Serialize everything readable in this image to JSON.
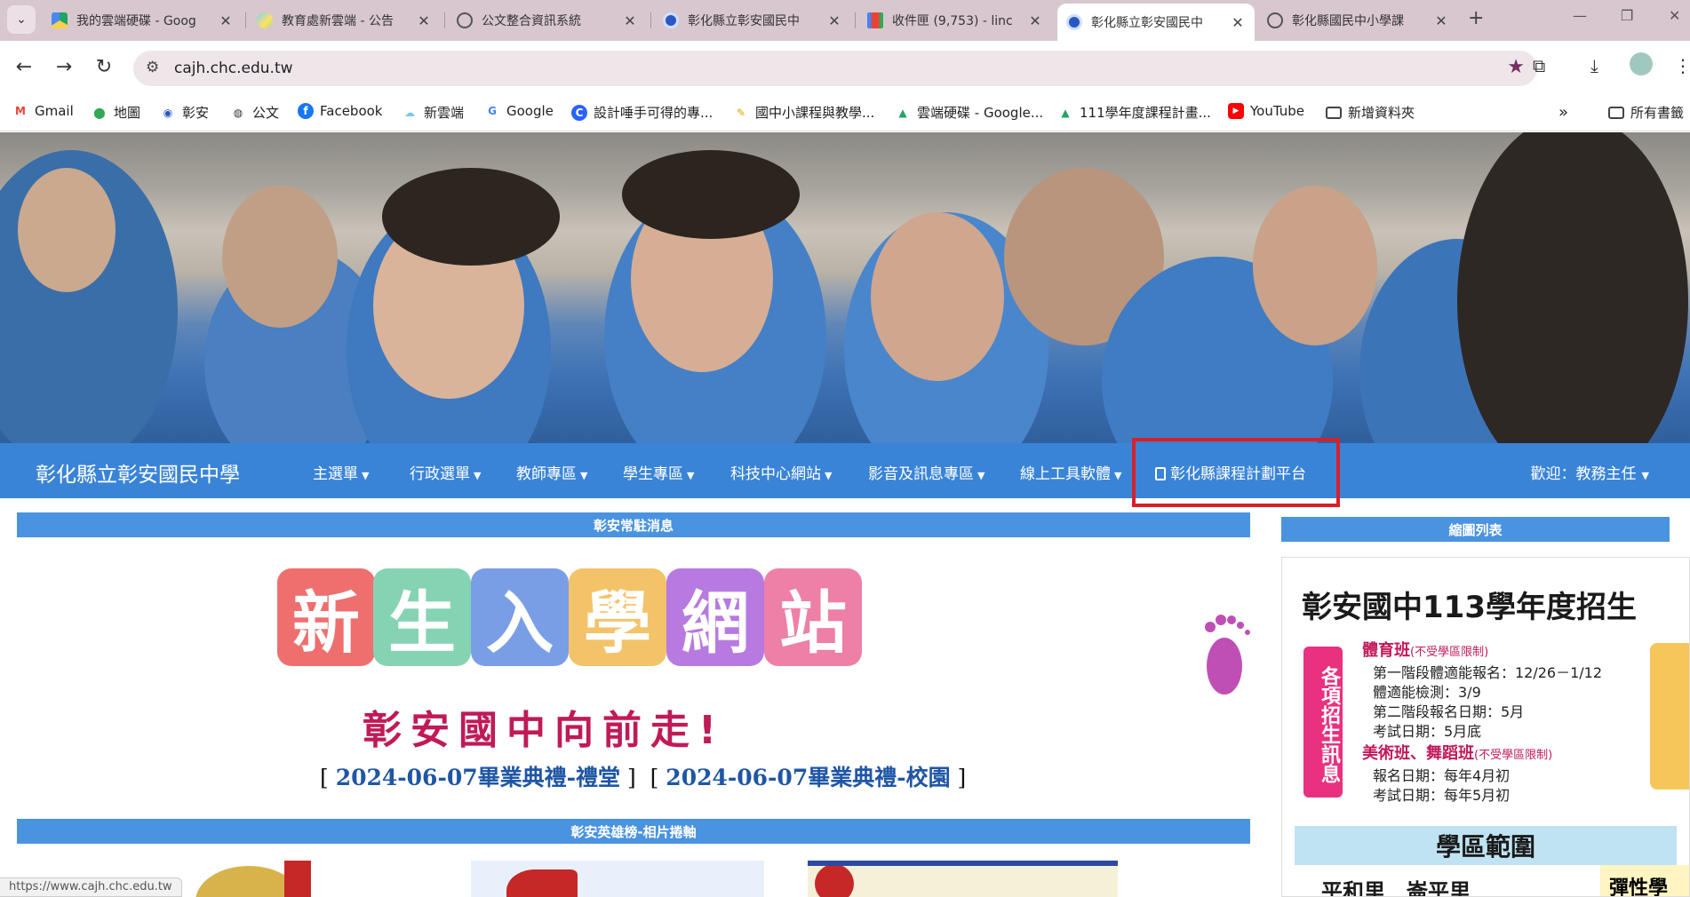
{
  "browser": {
    "tabs": [
      {
        "title": "我的雲端硬碟 - Goog",
        "favicon": "google-drive-icon"
      },
      {
        "title": "教育處新雲端 - 公告",
        "favicon": "cloud-icon"
      },
      {
        "title": "公文整合資訊系統",
        "favicon": "globe-icon"
      },
      {
        "title": "彰化縣立彰安國民中",
        "favicon": "school-icon"
      },
      {
        "title": "收件匣 (9,753) - linc",
        "favicon": "gmail-icon"
      },
      {
        "title": "彰化縣立彰安國民中",
        "favicon": "school-icon",
        "active": true
      },
      {
        "title": "彰化縣國民中小學課",
        "favicon": "globe-icon"
      }
    ],
    "url": "cajh.chc.edu.tw",
    "bookmarks": [
      {
        "label": "Gmail",
        "icon": "gmail-icon"
      },
      {
        "label": "地圖",
        "icon": "maps-icon"
      },
      {
        "label": "彰安",
        "icon": "school-icon"
      },
      {
        "label": "公文",
        "icon": "globe-icon"
      },
      {
        "label": "Facebook",
        "icon": "facebook-icon"
      },
      {
        "label": "新雲端",
        "icon": "cloud-icon"
      },
      {
        "label": "Google",
        "icon": "google-icon"
      },
      {
        "label": "設計唾手可得的專...",
        "icon": "c-logo-icon"
      },
      {
        "label": "國中小課程與教學...",
        "icon": "pencil-icon"
      },
      {
        "label": "雲端硬碟 - Google...",
        "icon": "google-drive-icon"
      },
      {
        "label": "111學年度課程計畫...",
        "icon": "google-drive-icon"
      },
      {
        "label": "YouTube",
        "icon": "youtube-icon"
      },
      {
        "label": "新增資料夾",
        "icon": "folder-icon"
      }
    ],
    "all_bookmarks": "所有書籤",
    "overflow": "»",
    "status_url": "https://www.cajh.chc.edu.tw"
  },
  "site": {
    "title": "彰化縣立彰安國民中學",
    "menu": [
      {
        "label": "主選單"
      },
      {
        "label": "行政選單"
      },
      {
        "label": "教師專區"
      },
      {
        "label": "學生專區"
      },
      {
        "label": "科技中心網站"
      },
      {
        "label": "影音及訊息專區"
      },
      {
        "label": "線上工具軟體"
      }
    ],
    "platform_link": "彰化縣課程計劃平台",
    "welcome": "歡迎：教務主任"
  },
  "main": {
    "notice_header": "彰安常駐消息",
    "banner_chars": [
      "新",
      "生",
      "入",
      "學",
      "網",
      "站"
    ],
    "banner_tile_colors": [
      "#ef6f6f",
      "#86d3b4",
      "#7a9ee6",
      "#f3c36a",
      "#b77ae0",
      "#ee7fa6"
    ],
    "banner_sub": "彰安國中向前走!",
    "links": [
      {
        "label": "2024-06-07畢業典禮-禮堂"
      },
      {
        "label": "2024-06-07畢業典禮-校園"
      }
    ],
    "hero_header": "彰安英雄榜-相片捲軸"
  },
  "sidebar": {
    "header": "縮圖列表",
    "poster": {
      "title": "彰安國中113學年度招生",
      "label": "各項招生訊息",
      "sports": "體育班",
      "sports_note": "(不受學區限制)",
      "line1": "第一階段體適能報名：12/26－1/12",
      "line2": "體適能檢測：3/9",
      "line3": "第二階段報名日期：5月",
      "line4": "考試日期：5月底",
      "arts": "美術班、舞蹈班",
      "arts_note": "(不受學區限制)",
      "line5": "報名日期：每年4月初",
      "line6": "考試日期：每年5月初",
      "region": "學區範圍",
      "areas": "平和里　崙平里",
      "flex": "彈性學"
    }
  },
  "colors": {
    "navbar": "#3a84d7",
    "section_header": "#4a93e0",
    "highlight": "#d8202a"
  }
}
